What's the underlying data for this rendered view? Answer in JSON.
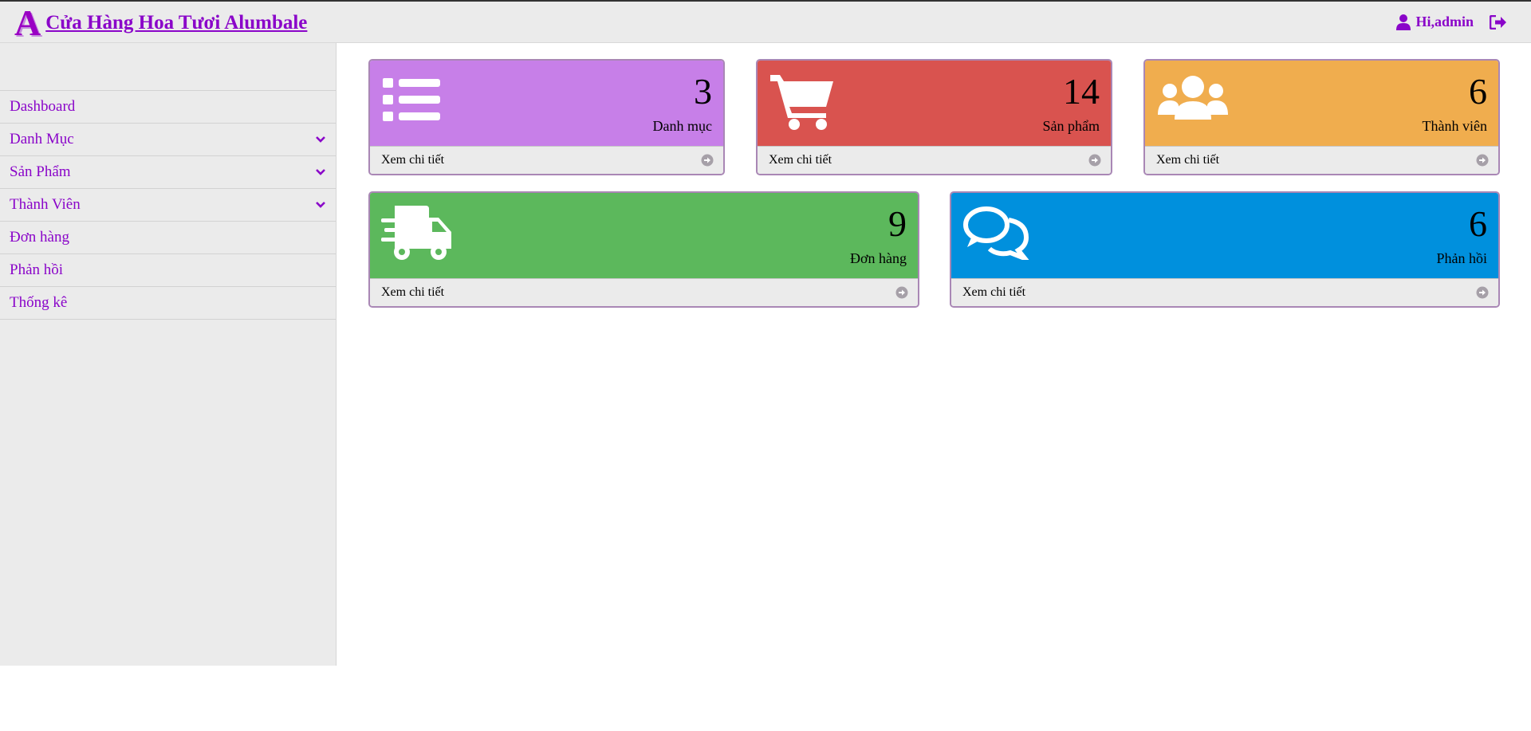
{
  "header": {
    "logo_letter": "A",
    "site_title": "Cửa Hàng Hoa Tươi Alumbale",
    "user_greeting": "Hi,admin",
    "user_icon": "user-icon",
    "logout_icon": "sign-out-icon",
    "accent_color": "#8a05c9"
  },
  "sidebar": {
    "items": [
      {
        "label": "Dashboard",
        "has_submenu": false
      },
      {
        "label": "Danh Mục",
        "has_submenu": true
      },
      {
        "label": "Sản Phẩm",
        "has_submenu": true
      },
      {
        "label": "Thành Viên",
        "has_submenu": true
      },
      {
        "label": "Đơn hàng",
        "has_submenu": false
      },
      {
        "label": "Phản hồi",
        "has_submenu": false
      },
      {
        "label": "Thống kê",
        "has_submenu": false
      }
    ]
  },
  "cards": [
    {
      "count": "3",
      "label": "Danh mục",
      "link": "Xem chi tiết",
      "color": "#c77fe8",
      "icon": "list-icon"
    },
    {
      "count": "14",
      "label": "Sản phẩm",
      "link": "Xem chi tiết",
      "color": "#d9534f",
      "icon": "shopping-cart-icon"
    },
    {
      "count": "6",
      "label": "Thành viên",
      "link": "Xem chi tiết",
      "color": "#f0ad4e",
      "icon": "users-icon"
    },
    {
      "count": "9",
      "label": "Đơn hàng",
      "link": "Xem chi tiết",
      "color": "#5cb85c",
      "icon": "truck-icon"
    },
    {
      "count": "6",
      "label": "Phản hồi",
      "link": "Xem chi tiết",
      "color": "#0090dd",
      "icon": "comments-icon"
    }
  ]
}
